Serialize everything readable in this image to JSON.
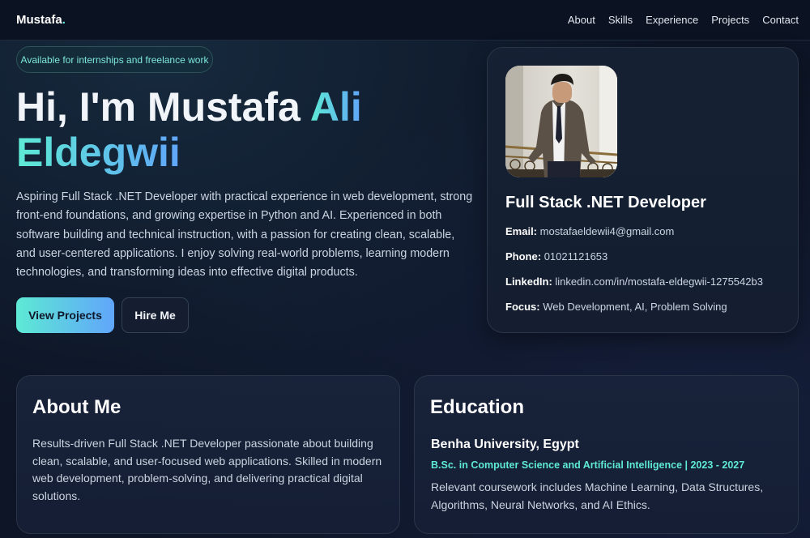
{
  "nav": {
    "logo": "Mustafa",
    "logo_dot": ".",
    "links": [
      "About",
      "Skills",
      "Experience",
      "Projects",
      "Contact"
    ]
  },
  "hero": {
    "badge": "Available for internships and freelance work",
    "title_prefix": "Hi, I'm Mustafa ",
    "title_highlight_1": "Ali",
    "title_highlight_2": "Eldegwii",
    "description": "Aspiring Full Stack .NET Developer with practical experience in web development, strong front-end foundations, and growing expertise in Python and AI. Experienced in both software building and technical instruction, with a passion for creating clean, scalable, and user-centered applications. I enjoy solving real-world problems, learning modern technologies, and transforming ideas into effective digital products.",
    "primary_button": "View Projects",
    "secondary_button": "Hire Me"
  },
  "profile": {
    "role": "Full Stack .NET Developer",
    "email_label": "Email:",
    "email": "mostafaeldewii4@gmail.com",
    "phone_label": "Phone:",
    "phone": "01021121653",
    "linkedin_label": "LinkedIn:",
    "linkedin": "linkedin.com/in/mostafa-eldegwii-1275542b3",
    "focus_label": "Focus:",
    "focus": "Web Development, AI, Problem Solving"
  },
  "about": {
    "title": "About Me",
    "text": "Results-driven Full Stack .NET Developer passionate about building clean, scalable, and user-focused web applications. Skilled in modern web development, problem-solving, and delivering practical digital solutions."
  },
  "education": {
    "title": "Education",
    "university": "Benha University, Egypt",
    "degree": "B.Sc. in Computer Science and Artificial Intelligence | 2023 - 2027",
    "text": "Relevant coursework includes Machine Learning, Data Structures, Algorithms, Neural Networks, and AI Ethics."
  },
  "colors": {
    "accent_teal": "#5eead4",
    "accent_blue": "#60a5fa",
    "background": "#0d1526"
  }
}
